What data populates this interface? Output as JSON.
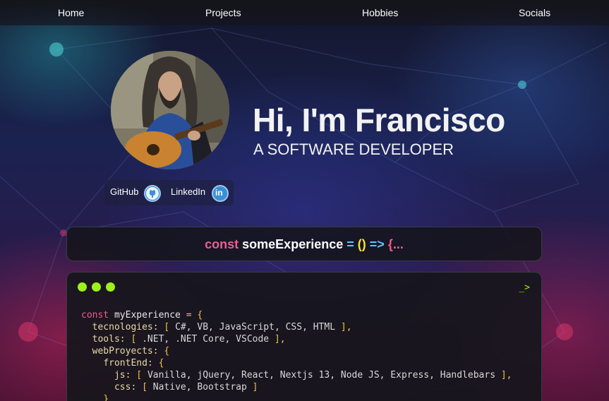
{
  "nav": {
    "items": [
      "Home",
      "Projects",
      "Hobbies",
      "Socials"
    ]
  },
  "hero": {
    "greeting": "Hi, I'm Francisco",
    "role": "A SOFTWARE DEVELOPER"
  },
  "socials": {
    "github_label": "GitHub",
    "linkedin_label": "LinkedIn",
    "linkedin_icon_text": "in"
  },
  "experience_bar": {
    "keyword": "const",
    "name": "someExperience",
    "equals": "=",
    "parens": "()",
    "arrow": "=>",
    "brace": "{",
    "ellipsis": "..."
  },
  "terminal": {
    "prompt": "_>",
    "code": {
      "decl_kw": "const",
      "decl_name": "myExperience",
      "technologies_key": "tecnologies:",
      "technologies": "C#, VB, JavaScript, CSS, HTML",
      "tools_key": "tools:",
      "tools": ".NET, .NET Core, VSCode",
      "webproyects_key": "webProyects:",
      "frontend_key": "frontEnd:",
      "js_key": "js:",
      "js": "Vanilla, jQuery, React, Nextjs 13, Node JS, Express, Handlebars",
      "css_key": "css:",
      "css": "Native, Bootstrap"
    }
  },
  "colors": {
    "accent_pink": "#ee5c8d",
    "accent_yellow": "#f3e23a",
    "accent_blue": "#5fc5ff",
    "terminal_green": "#9ef01a"
  }
}
